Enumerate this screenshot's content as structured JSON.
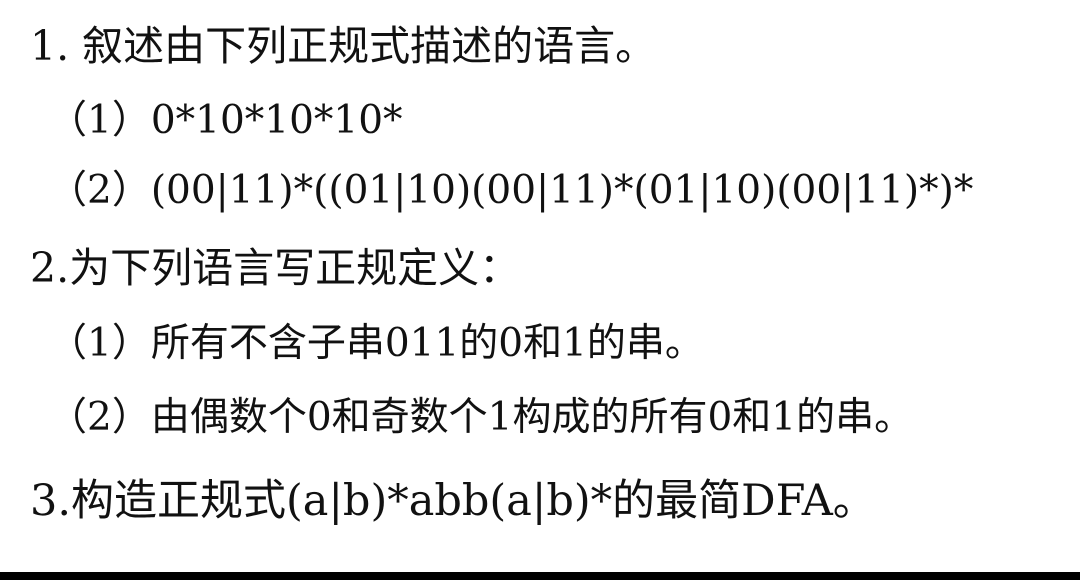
{
  "questions": [
    {
      "title": "1. 叙述由下列正规式描述的语言。",
      "subitems": [
        "（1）0*10*10*10*",
        "（2）(00|11)*((01|10)(00|11)*(01|10)(00|11)*)*"
      ]
    },
    {
      "title": "2.为下列语言写正规定义：",
      "subitems": [
        "（1）所有不含子串011的0和1的串。",
        "（2）由偶数个0和奇数个1构成的所有0和1的串。"
      ]
    },
    {
      "title": "3.构造正规式(a|b)*abb(a|b)*的最简DFA。",
      "subitems": []
    }
  ]
}
